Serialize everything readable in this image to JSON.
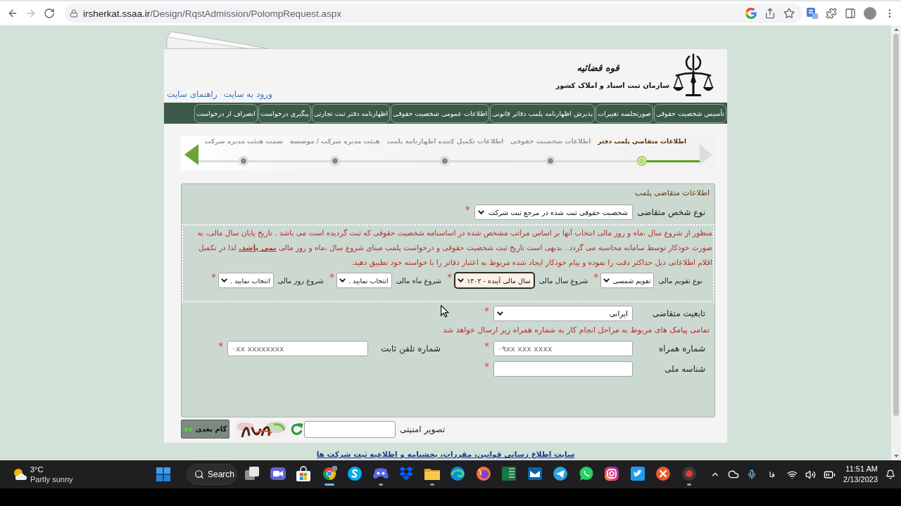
{
  "browser": {
    "url_domain": "irsherkat.ssaa.ir",
    "url_path": "/Design/RqstAdmission/PolompRequest.aspx"
  },
  "header": {
    "logo_title": "قوه قضائیه",
    "logo_subtitle": "سازمان ثبت اسناد و املاک کشور",
    "links": [
      "ورود به سایت",
      "راهنمای سایت"
    ]
  },
  "nav": [
    "تأسیس شخصیت حقوقی",
    "صورتجلسه تغییرات",
    "پذیرش اظهارنامه پلمب دفاتر قانونی",
    "اطلاعات عمومی شخصیت حقوقی",
    "اظهارنامه دفتر ثبت تجارتی",
    "پیگیری درخواست",
    "انصراف از درخواست"
  ],
  "stepper": [
    {
      "label": "اطلاعات متقاضی پلمب دفتر",
      "selected": true
    },
    {
      "label": "اطلاعات شخصیت حقوقی",
      "selected": false
    },
    {
      "label": "اطلاعات تکمیل کننده اظهارنامه پلمب",
      "selected": false
    },
    {
      "label": "هیئت مدیره شرکت / موسسه",
      "selected": false
    },
    {
      "label": "سمت هیئت مدیره شرکت",
      "selected": false
    }
  ],
  "form": {
    "title": "اطلاعات متقاضی پلمب",
    "applicant_type": {
      "label": "نوع شخص متقاضی",
      "value": "شخصیت حقوقی ثبت شده در مرجع ثبت شرکت",
      "required_mark": "*"
    },
    "notice": "منظور از شروع سال ،ماه و روز مالی انتخاب آنها بر اساس مراتب مشخص شده در اساسنامه شخصیت حقوقی که ثبت گردیده است می باشد . تاریخ پایان سال مالی، به صورت خودکار توسط سامانه محاسبه می گردد . بدیهی است تاریخ ثبت شخصیت حقوقی و درخواست پلمب مبنای شروع سال ،ماه و روز مالی **نمی باشد.** لذا در تکمیل اقلام اطلاعاتی ذیل حداکثر دقت را نموده و پیام خودکار ایجاد شده مربوط به اعتبار دفاتر را با خواسته خود تطبیق دهید.",
    "fiscal_fields": [
      {
        "label": "نوع تقویم مالی",
        "value": "تقویم شمسی",
        "required_mark": "*",
        "focused": false
      },
      {
        "label": "شروع سال مالی",
        "value": "سال مالی آینده - ۱۴۰۲",
        "required_mark": "*",
        "focused": true
      },
      {
        "label": "شروع ماه مالی",
        "value": "انتخاب نمایید .",
        "required_mark": "*",
        "focused": false
      },
      {
        "label": "شروع روز مالی",
        "value": "انتخاب نمایید .",
        "required_mark": "*",
        "focused": false
      }
    ],
    "nationality": {
      "label": "تابعیت متقاضی",
      "value": "ایرانی",
      "required_mark": "*"
    },
    "sms_note": "تمامی پیامک های مربوط به مراحل انجام کار به شماره همراه زیر ارسال خواهد شد",
    "contact_fields": [
      {
        "label": "شماره همراه",
        "placeholder": "۰۹xx xxx xxxx",
        "required_mark": "*"
      },
      {
        "label": "شماره تلفن ثابت",
        "placeholder": "۰xx xxxxxxxx",
        "required_mark": "*"
      }
    ],
    "national_id": {
      "label": "شناسه ملی",
      "required_mark": "*"
    }
  },
  "captcha": {
    "label": "تصویر امنیتی"
  },
  "next_button": "گام بعدی",
  "footer_link": "سایت اطلاع رسانی قوانین، مقررات، بخشنامه و اطلاعیه ثبت شرکت ها",
  "taskbar": {
    "weather_temp": "3°C",
    "weather_text": "Partly sunny",
    "search": "Search",
    "apps": [
      {
        "kind": "overlap",
        "running": false,
        "selected": false
      },
      {
        "kind": "videochat",
        "running": false,
        "selected": false
      },
      {
        "kind": "bag",
        "running": false,
        "selected": false
      },
      {
        "kind": "ring",
        "running": true,
        "selected": true
      },
      {
        "kind": "chatcircle",
        "running": false,
        "selected": false
      },
      {
        "kind": "gamepad",
        "running": true,
        "selected": false
      },
      {
        "kind": "boxes",
        "running": false,
        "selected": false
      },
      {
        "kind": "folder",
        "running": true,
        "selected": false
      },
      {
        "kind": "swirl",
        "running": false,
        "selected": false
      },
      {
        "kind": "flame",
        "running": false,
        "selected": false
      },
      {
        "kind": "sheet",
        "running": false,
        "selected": false
      },
      {
        "kind": "mail",
        "running": false,
        "selected": false
      },
      {
        "kind": "plane",
        "running": false,
        "selected": false
      },
      {
        "kind": "phone",
        "running": false,
        "selected": false
      },
      {
        "kind": "camera",
        "running": false,
        "selected": false
      },
      {
        "kind": "bird",
        "running": false,
        "selected": false
      },
      {
        "kind": "arrows",
        "running": false,
        "selected": false
      },
      {
        "kind": "record",
        "running": true,
        "selected": false
      }
    ],
    "language": "فا",
    "time": "11:51 AM",
    "date": "2/13/2023"
  }
}
